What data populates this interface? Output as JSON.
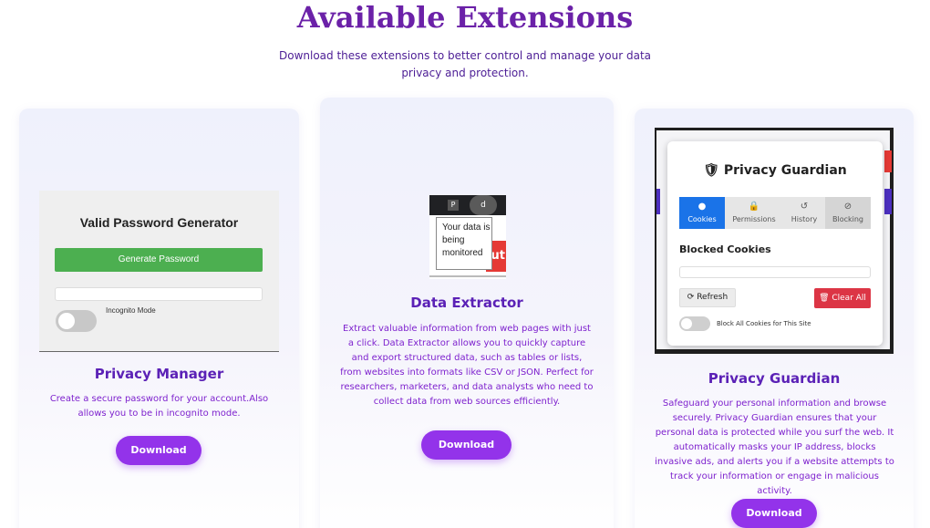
{
  "header": {
    "title": "Available Extensions",
    "subtitle": "Download these extensions to better control and manage your data privacy and protection."
  },
  "cards": [
    {
      "title": "Privacy Manager",
      "description": "Create a secure password for your account.Also allows you to be in incognito mode.",
      "button": "Download",
      "preview": {
        "heading": "Valid Password Generator",
        "generate_label": "Generate Password",
        "password_value": "",
        "incognito_label": "Incognito Mode",
        "incognito_on": false,
        "button_color": "#4caf50"
      }
    },
    {
      "title": "Data Extractor",
      "description": "Extract valuable information from web pages with just a click. Data Extractor allows you to quickly capture and export structured data, such as tables or lists, from websites into formats like CSV or JSON. Perfect for researchers, marketers, and data analysts who need to collect data from web sources efficiently.",
      "button": "Download",
      "preview": {
        "ext_icon_1": "P",
        "ext_icon_2": "d",
        "tooltip": "Your data is being monitored",
        "red_fragment": "ut"
      }
    },
    {
      "title": "Privacy Guardian",
      "description": "Safeguard your personal information and browse securely. Privacy Guardian ensures that your personal data is protected while you surf the web. It automatically masks your IP address, blocks invasive ads, and alerts you if a website attempts to track your information or engage in malicious activity.",
      "button": "Download",
      "preview": {
        "popup_title": "Privacy Guardian",
        "tabs": [
          {
            "label": "Cookies",
            "icon": "cookie-icon",
            "glyph": "●",
            "active": true
          },
          {
            "label": "Permissions",
            "icon": "lock-icon",
            "glyph": "🔒",
            "active": false
          },
          {
            "label": "History",
            "icon": "history-icon",
            "glyph": "↺",
            "active": false
          },
          {
            "label": "Blocking",
            "icon": "block-icon",
            "glyph": "⊘",
            "active": false
          }
        ],
        "section_title": "Blocked Cookies",
        "refresh_label": "Refresh",
        "clear_label": "Clear All",
        "block_all_label": "Block All Cookies for This Site",
        "block_all_on": false
      }
    }
  ],
  "colors": {
    "title": "#6b21a8",
    "accent": "#9333ea",
    "card_text": "#7e22ce",
    "active_tab": "#1a73e8",
    "danger": "#dc3545"
  }
}
